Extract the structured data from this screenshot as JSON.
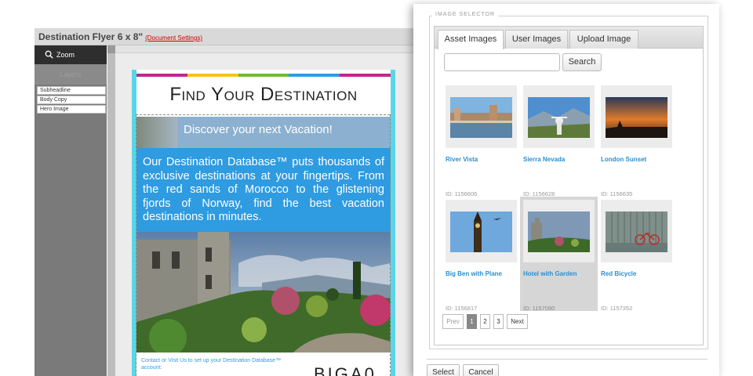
{
  "editor": {
    "title": "Destination Flyer 6 x 8\"",
    "doc_settings_link": "(Document Settings)",
    "zoom_label": "Zoom",
    "layers_label": "Layers",
    "layers": [
      "Subheadline",
      "Body Copy",
      "Hero Image"
    ],
    "selected_layer": "Hero Image"
  },
  "flyer": {
    "headline": "Find Your Destination",
    "subheadline": "Discover your next Vacation!",
    "body": "Our Destination Database™ puts thousands of exclusive destinations at your fingertips. From the red sands of Morocco to the glistening fjords of Norway, find the best vacation destinations in minutes.",
    "footer": "Contact or Visit Us to set up your Destination Database™ account:",
    "logo_text": "BIGA0",
    "accent_colors": [
      "#c0278f",
      "#f5c518",
      "#6dbb3f",
      "#2f9be0",
      "#c0278f"
    ],
    "frame_color": "#5ad6e6",
    "body_bg": "#2f9be0"
  },
  "modal": {
    "legend": "IMAGE SELECTOR",
    "tabs": [
      "Asset Images",
      "User Images",
      "Upload Image"
    ],
    "active_tab": "Asset Images",
    "search": {
      "value": "",
      "placeholder": "",
      "button": "Search"
    },
    "images": [
      {
        "title": "River Vista",
        "id": "ID: 1156606",
        "icon": "river-photo"
      },
      {
        "title": "Sierra Nevada",
        "id": "ID: 1156628",
        "icon": "mountain-photo"
      },
      {
        "title": "London Sunset",
        "id": "ID: 1156635",
        "icon": "sunset-photo"
      },
      {
        "title": "Big Ben with Plane",
        "id": "ID: 1156817",
        "icon": "clocktower-photo"
      },
      {
        "title": "Hotel with Garden",
        "id": "ID: 1157080",
        "icon": "castle-photo"
      },
      {
        "title": "Red Bicycle",
        "id": "ID: 1157352",
        "icon": "bicycle-photo"
      }
    ],
    "selected_image": "Hotel with Garden",
    "pagination": {
      "prev": "Prev",
      "pages": [
        "1",
        "2",
        "3"
      ],
      "current": "1",
      "next": "Next"
    },
    "buttons": {
      "select": "Select",
      "cancel": "Cancel"
    },
    "link_color": "#2a8fd0"
  }
}
